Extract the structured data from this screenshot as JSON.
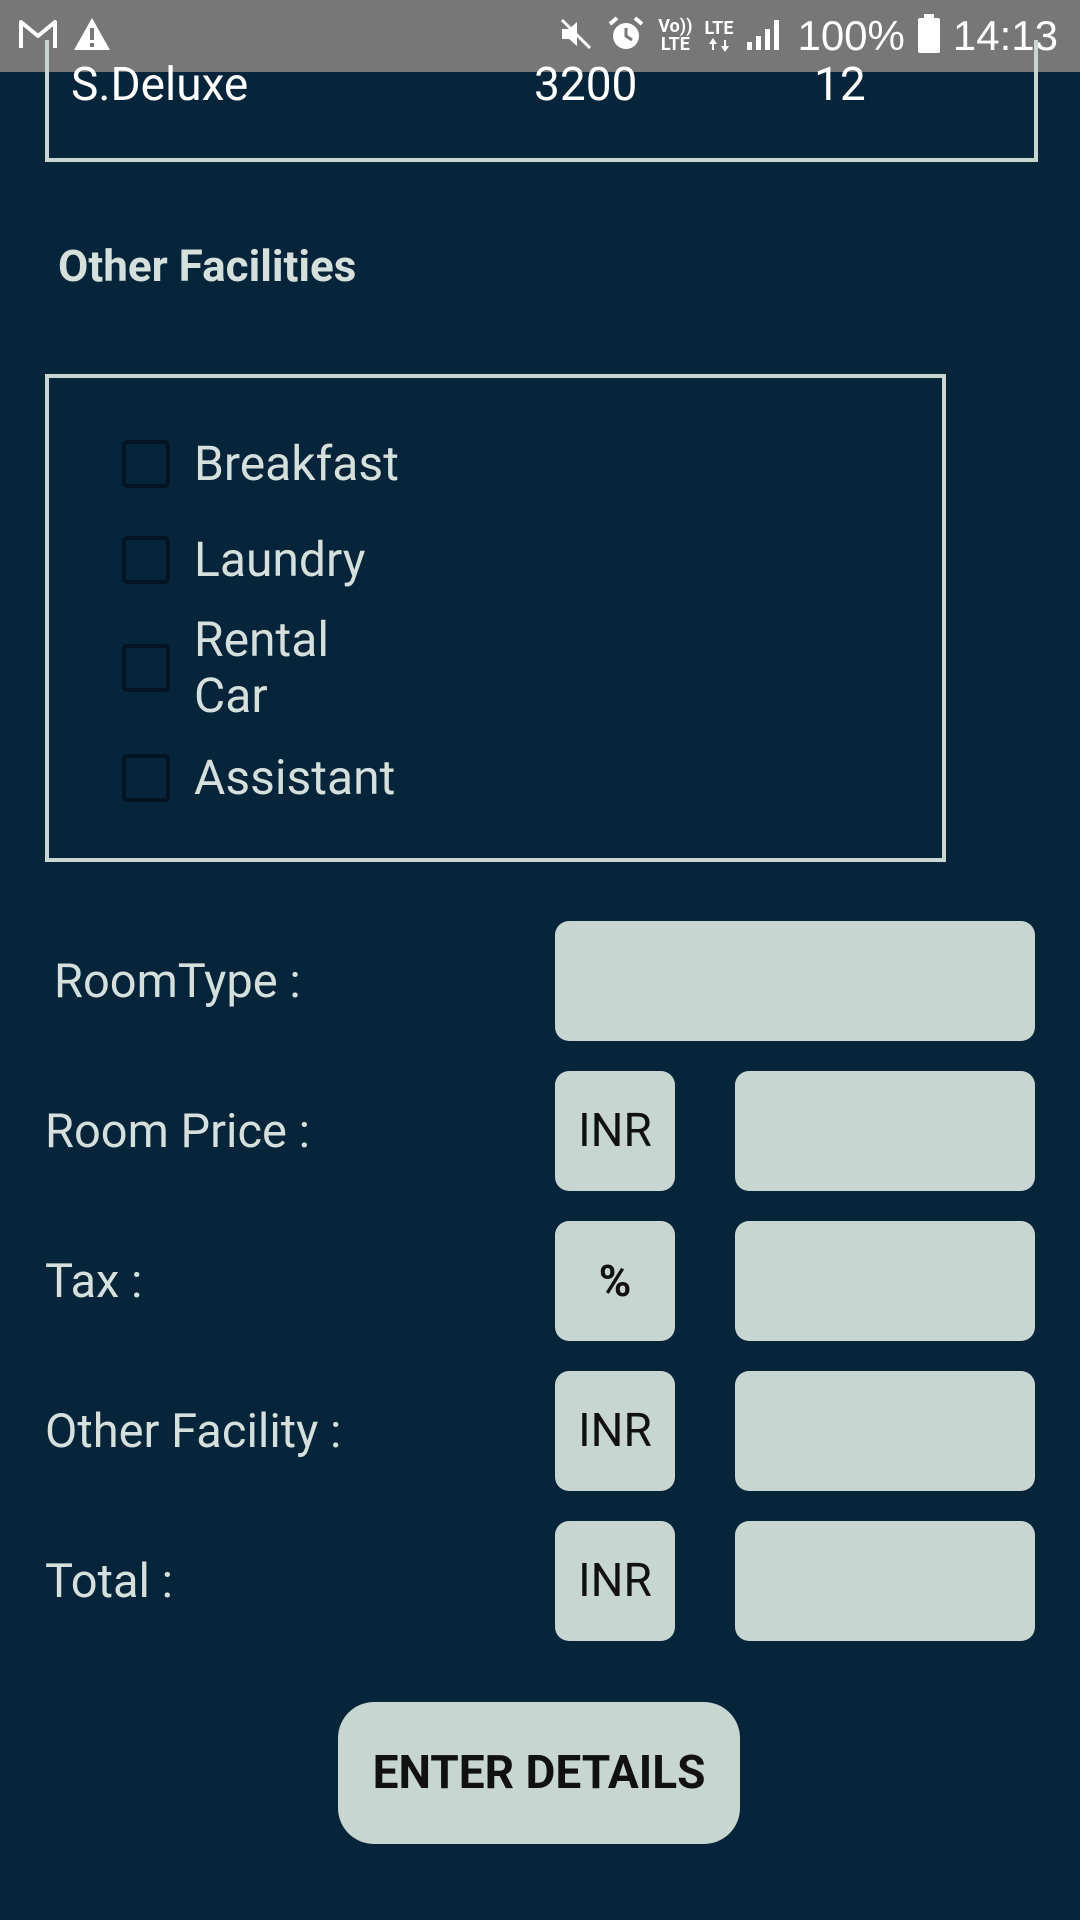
{
  "status_bar": {
    "battery": "100%",
    "time": "14:13",
    "volte_label": "Vo))\nLTE",
    "lte_label": "LTE",
    "icons": [
      "gmail-icon",
      "warning-icon",
      "mute-icon",
      "alarm-icon",
      "volte-icon",
      "lte-data-icon",
      "signal-icon",
      "battery-icon"
    ]
  },
  "room_table": {
    "row": {
      "type": "S.Deluxe",
      "price": "3200",
      "count": "12"
    }
  },
  "facilities": {
    "title": "Other Facilities",
    "options": [
      {
        "label": "Breakfast",
        "checked": false
      },
      {
        "label": "Laundry",
        "checked": false
      },
      {
        "label": "Rental\nCar",
        "checked": false
      },
      {
        "label": "Assistant",
        "checked": false
      }
    ]
  },
  "form": {
    "room_type_label": "RoomType :",
    "room_type_value": "",
    "room_price_label": "Room Price :",
    "room_price_unit": "INR",
    "room_price_value": "",
    "tax_label": "Tax :",
    "tax_unit": "%",
    "tax_value": "",
    "other_facility_label": "Other Facility :",
    "other_facility_unit": "INR",
    "other_facility_value": "",
    "total_label": "Total :",
    "total_unit": "INR",
    "total_value": ""
  },
  "actions": {
    "enter_details_label": "ENTER DETAILS"
  },
  "colors": {
    "background": "#06243a",
    "status_bar": "#777777",
    "field": "#c8d6d1",
    "text_light": "#d5dfdc"
  }
}
